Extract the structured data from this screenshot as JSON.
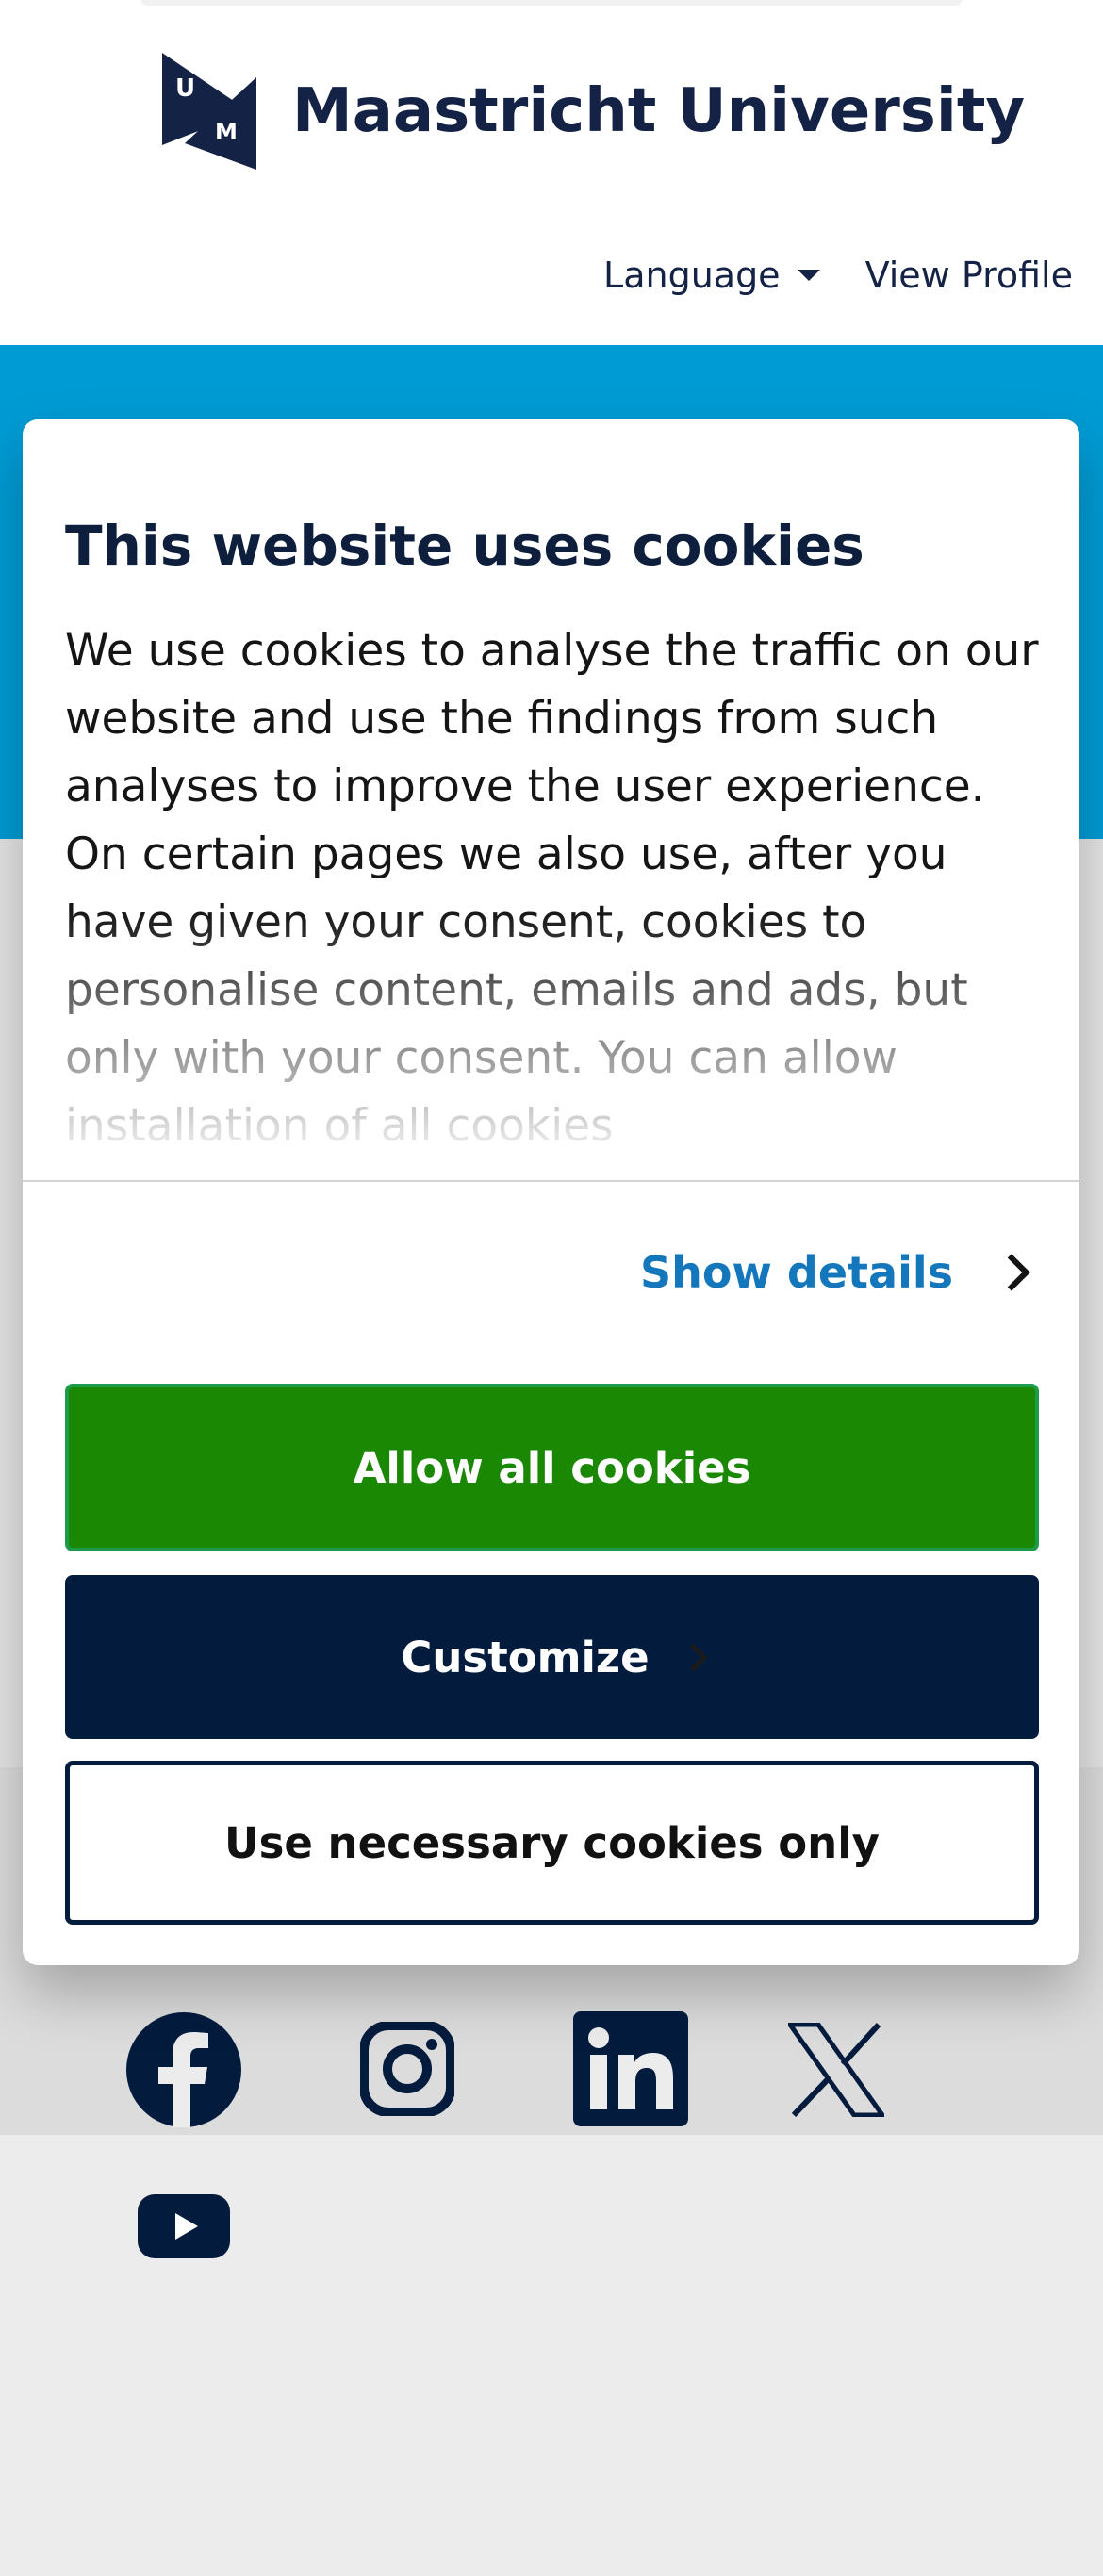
{
  "header": {
    "logo_text": "Maastricht University",
    "logo_mark_letters": "UM",
    "nav": {
      "language_label": "Language",
      "view_profile_label": "View Profile"
    }
  },
  "cookie_dialog": {
    "title": "This website uses cookies",
    "body": "We use cookies to analyse the traffic on our website and use the findings from such analyses to improve the user experience. On certain pages we also use, after you have given your consent, cookies to personalise content, emails and ads, but only with your consent. You can allow installation of all cookies",
    "show_details_label": "Show details",
    "allow_all_label": "Allow all cookies",
    "customize_label": "Customize",
    "necessary_only_label": "Use necessary cookies only"
  },
  "social": {
    "icons": [
      "facebook-icon",
      "instagram-icon",
      "linkedin-icon",
      "x-icon",
      "youtube-icon"
    ]
  },
  "colors": {
    "brand_navy": "#031c3e",
    "hero_blue": "#009bd4",
    "allow_green": "#1a8802",
    "link_blue": "#1477bb"
  }
}
